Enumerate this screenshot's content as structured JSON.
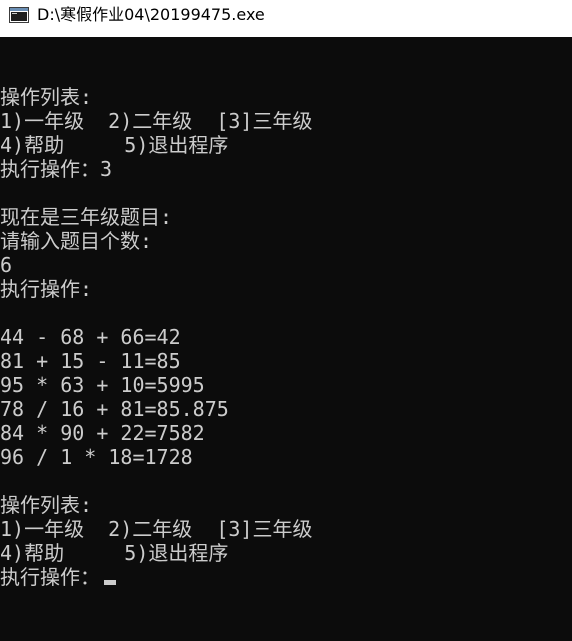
{
  "window": {
    "title": "D:\\寒假作业04\\20199475.exe",
    "icon": "console-app-icon"
  },
  "console": {
    "lines": [
      "操作列表:",
      "1)一年级  2)二年级  [3]三年级",
      "4)帮助     5)退出程序",
      "执行操作：3",
      "",
      "现在是三年级题目:",
      "请输入题目个数:",
      "6",
      "执行操作:",
      "",
      "44 - 68 + 66=42",
      "81 + 15 - 11=85",
      "95 * 63 + 10=5995",
      "78 / 16 + 81=85.875",
      "84 * 90 + 22=7582",
      "96 / 1 * 18=1728",
      "",
      "操作列表:",
      "1)一年级  2)二年级  [3]三年级",
      "4)帮助     5)退出程序",
      "执行操作："
    ]
  }
}
